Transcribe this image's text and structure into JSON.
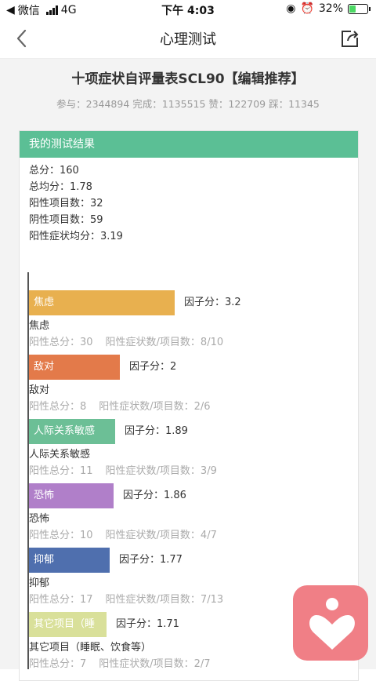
{
  "status_bar": {
    "carrier": "微信",
    "network": "4G",
    "time": "下午 4:03",
    "battery": "32%"
  },
  "nav": {
    "title": "心理测试"
  },
  "header": {
    "title": "十项症状自评量表SCL90【编辑推荐】",
    "stats": "参与：2344894 完成：1135515 赞：122709 踩：11345"
  },
  "result": {
    "heading": "我的测试结果",
    "lines": [
      "总分：160",
      "总均分：1.78",
      "阳性项目数：32",
      "阴性项目数：59",
      "阳性症状均分：3.19"
    ]
  },
  "chart_data": {
    "type": "bar",
    "orientation": "horizontal",
    "categories": [
      "焦虑",
      "敌对",
      "人际关系敏感",
      "恐怖",
      "抑郁",
      "其它项目（睡眠、饮食等）"
    ],
    "bar_labels": [
      "焦虑",
      "敌对",
      "人际关系敏感",
      "恐怖",
      "抑郁",
      "其它项目（睡"
    ],
    "values": [
      3.2,
      2,
      1.89,
      1.86,
      1.77,
      1.71
    ],
    "factor_labels": [
      "因子分：3.2",
      "因子分：2",
      "因子分：1.89",
      "因子分：1.86",
      "因子分：1.77",
      "因子分：1.71"
    ],
    "positive_totals": [
      "阳性总分：30",
      "阳性总分：8",
      "阳性总分：11",
      "阳性总分：10",
      "阳性总分：17",
      "阳性总分：7"
    ],
    "positive_ratios": [
      "阳性症状数/项目数：8/10",
      "阳性症状数/项目数：2/6",
      "阳性症状数/项目数：3/9",
      "阳性症状数/项目数：4/7",
      "阳性症状数/项目数：7/13",
      "阳性症状数/项目数：2/7"
    ],
    "colors": [
      "#e8b04f",
      "#e37a4a",
      "#6cbf96",
      "#b07fc9",
      "#4f6fae",
      "#d9e09a"
    ]
  }
}
